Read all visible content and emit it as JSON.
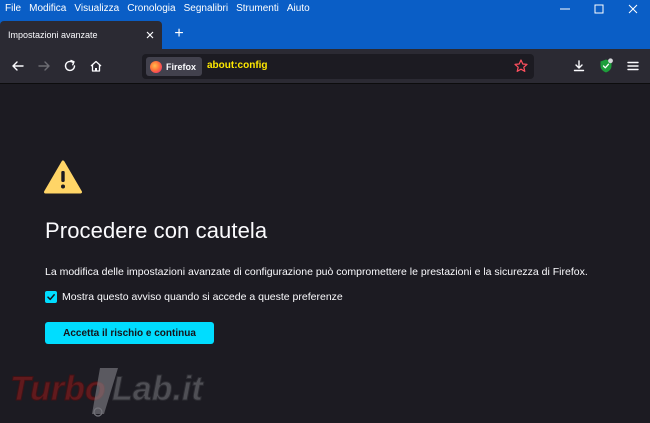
{
  "menubar": {
    "items": [
      "File",
      "Modifica",
      "Visualizza",
      "Cronologia",
      "Segnalibri",
      "Strumenti",
      "Aiuto"
    ]
  },
  "window": {
    "minimize_glyph": "—",
    "maximize_glyph": "☐",
    "close_glyph": "✕"
  },
  "tab": {
    "title": "Impostazioni avanzate",
    "close_glyph": "✕",
    "new_tab_glyph": "+"
  },
  "urlbar": {
    "identity_label": "Firefox",
    "url": "about:config"
  },
  "page": {
    "heading": "Procedere con cautela",
    "description": "La modifica delle impostazioni avanzate di configurazione può compromettere le prestazioni e la sicurezza di Firefox.",
    "checkbox_label": "Mostra questo avviso quando si accede a queste preferenze",
    "checkbox_checked": true,
    "accept_button": "Accetta il rischio e continua"
  },
  "watermark": {
    "text": "TurboLab.it"
  },
  "icons": {
    "back": "arrow-left-icon",
    "forward": "arrow-right-icon",
    "reload": "reload-icon",
    "home": "home-icon",
    "bookmark": "star-icon",
    "downloads": "download-icon",
    "extension": "shield-icon",
    "menu": "hamburger-menu-icon",
    "warning": "warning-icon"
  },
  "colors": {
    "titlebar": "#0a5ec6",
    "toolbar": "#2b2a33",
    "content_bg": "#1c1b22",
    "accent": "#00ddff",
    "url_text": "#ffe900",
    "warning": "#ffd567"
  }
}
